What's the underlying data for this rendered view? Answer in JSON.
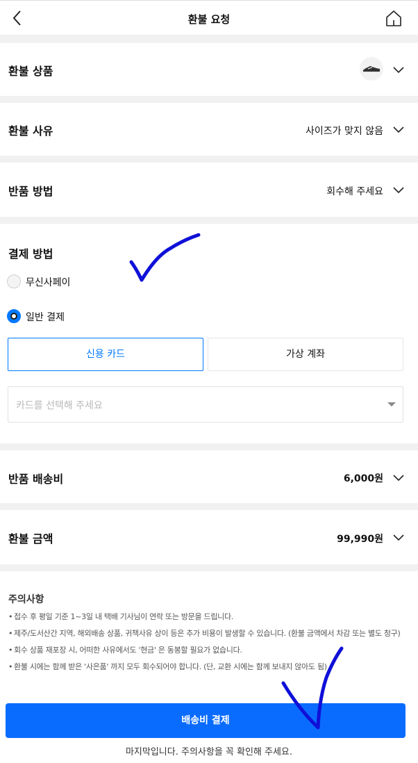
{
  "header": {
    "title": "환불 요청",
    "back_icon": "chevron-left-icon",
    "home_icon": "home-icon"
  },
  "sections": {
    "refund_item": {
      "label": "환불 상품"
    },
    "refund_reason": {
      "label": "환불 사유",
      "value": "사이즈가 맞지 않음"
    },
    "return_method": {
      "label": "반품 방법",
      "value": "회수해 주세요"
    },
    "payment": {
      "label": "결제 방법",
      "options": [
        {
          "label": "무신사페이",
          "selected": false
        },
        {
          "label": "일반 결제",
          "selected": true
        }
      ],
      "tabs": [
        {
          "label": "신용 카드",
          "active": true
        },
        {
          "label": "가상 계좌",
          "active": false
        }
      ],
      "card_placeholder": "카드를 선택해 주세요"
    },
    "shipping_fee": {
      "label": "반품 배송비",
      "value": "6,000원"
    },
    "refund_amount": {
      "label": "환불 금액",
      "value": "99,990원"
    }
  },
  "notice": {
    "title": "주의사항",
    "items": [
      "접수 후 평일 기준 1~3일 내 택배 기사님이 연락 또는 방문을 드립니다.",
      "제주/도서산간 지역, 해외배송 상품, 귀책사유 상이 등은 추가 비용이 발생할 수 있습니다. (환불 금액에서 차감 또는 별도 청구)",
      "회수 상품 재포장 시, 어떠한 사유에서도 '현금' 은 동봉할 필요가 없습니다.",
      "환불 시에는 함께 받은 '사은품' 까지 모두 회수되어야 합니다. (단, 교환 시에는 함께 보내지 않아도 됨)"
    ]
  },
  "footer": {
    "pay_button": "배송비 결제",
    "note": "마지막입니다. 주의사항을 꼭 확인해 주세요."
  },
  "colors": {
    "accent": "#0078ff",
    "button": "#0a6cff",
    "gap": "#f1f1f1",
    "scribble": "#1010d8"
  }
}
